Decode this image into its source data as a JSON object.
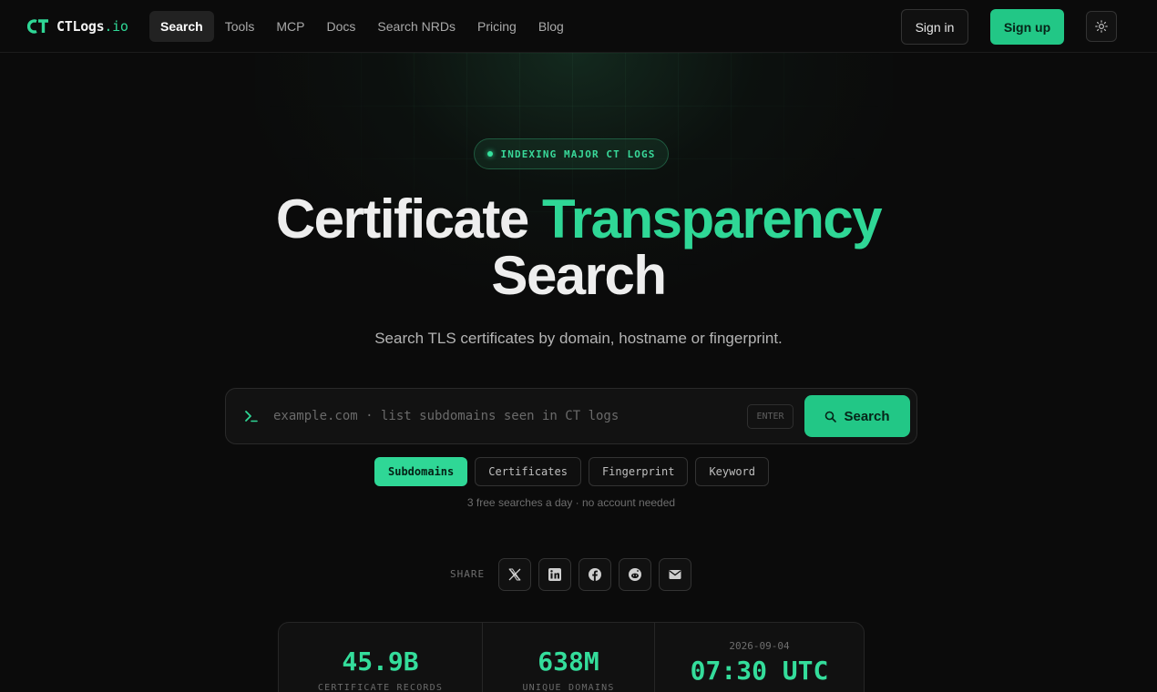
{
  "nav": {
    "logo_initials": "CT",
    "logo_name": "CTLogs",
    "logo_tld": ".io",
    "links": [
      "Search",
      "Tools",
      "MCP",
      "Docs",
      "Search NRDs",
      "Pricing",
      "Blog"
    ],
    "active_link": "Search",
    "sign_in": "Sign in",
    "sign_up": "Sign up",
    "theme_icon": "sun-icon"
  },
  "hero": {
    "badge": "INDEXING MAJOR CT LOGS",
    "headline_part1": "Certificate",
    "headline_accent": "Transparency",
    "headline_part2": "Search",
    "subtitle": "Search TLS certificates by domain, hostname or fingerprint."
  },
  "search": {
    "placeholder": "example.com · list subdomains seen in CT logs",
    "value": "",
    "enter_hint": "ENTER",
    "button_label": "Search",
    "modes": [
      "Subdomains",
      "Certificates",
      "Fingerprint",
      "Keyword"
    ],
    "active_mode": "Subdomains",
    "note": "3 free searches a day · no account needed"
  },
  "share": {
    "label": "SHARE",
    "icons": [
      "x-icon",
      "linkedin-icon",
      "facebook-icon",
      "reddit-icon",
      "email-icon"
    ]
  },
  "stats": {
    "records_value": "45.9B",
    "records_label": "CERTIFICATE RECORDS",
    "domains_value": "638M",
    "domains_label": "UNIQUE DOMAINS",
    "date": "2026-09-04",
    "time": "07:30 UTC"
  },
  "colors": {
    "accent": "#2fd796",
    "button": "#22c786",
    "background": "#0b0b0b"
  }
}
